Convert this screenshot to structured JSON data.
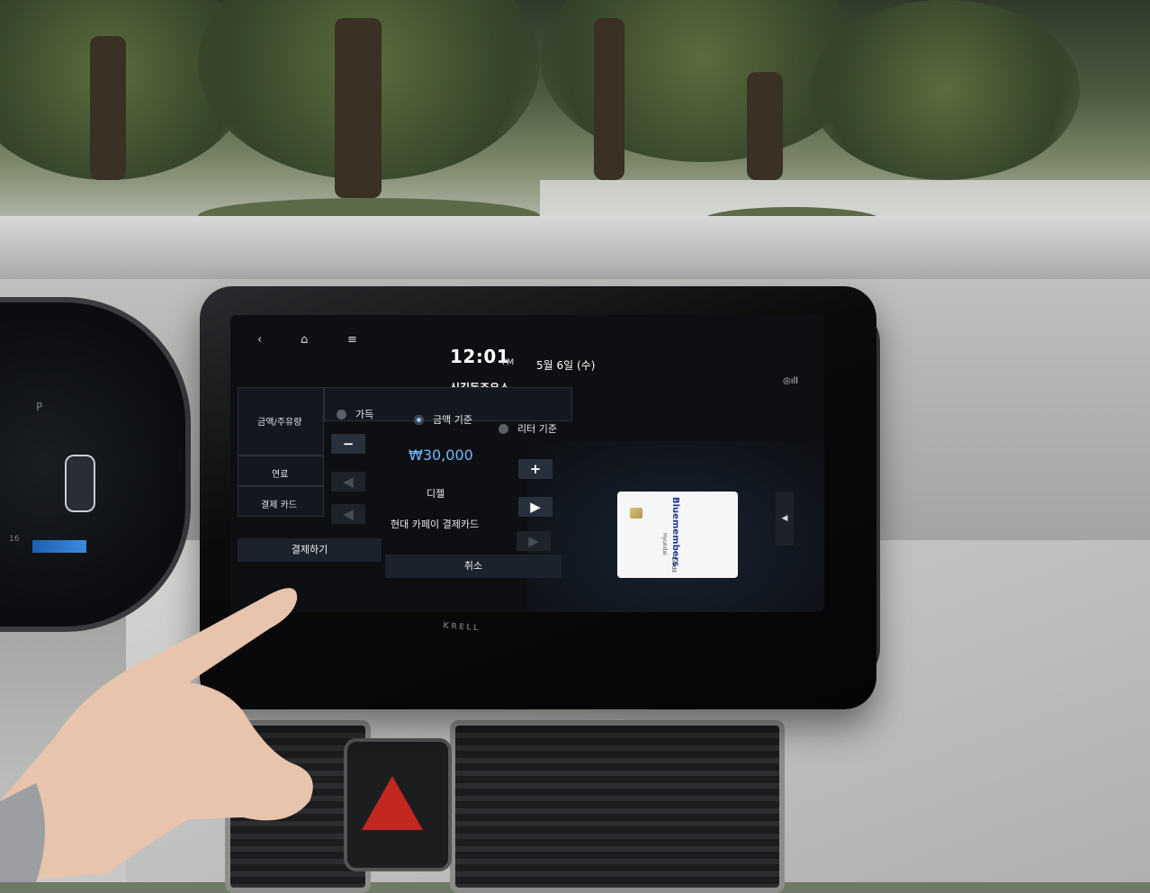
{
  "screen": {
    "time": "12:01",
    "ampm": "PM",
    "date": "5월 6일 (수)",
    "station_name": "신길동주유소",
    "nav": {
      "back": "‹",
      "home": "⌂",
      "menu": "≡"
    },
    "status_icon": "◎ıll",
    "form": {
      "amount_row_label": "금액/주유량",
      "options": [
        {
          "label": "가득",
          "selected": false
        },
        {
          "label": "금액 기준",
          "selected": true
        },
        {
          "label": "리터 기준",
          "selected": false
        }
      ],
      "minus": "−",
      "plus": "+",
      "amount": "₩30,000",
      "fuel_label": "연료",
      "fuel_value": "디젤",
      "card_label": "결제 카드",
      "card_value": "현대 카페이 결제카드",
      "prev": "◀",
      "next": "▶",
      "pay_button": "결제하기",
      "cancel_button": "취소"
    },
    "credit_card": {
      "brand": "Bluemembers",
      "sub": "Credit",
      "issuer": "Hyundai"
    },
    "side_tab": "◀"
  },
  "cluster": {
    "gear": "P",
    "speed_small": "16"
  },
  "bezel_brand": "KRELL",
  "colors": {
    "accent": "#6fb8ff",
    "hazard": "#c2281f",
    "screen_bg": "#0e0f12"
  },
  "icons": [
    "back-icon",
    "home-icon",
    "menu-icon",
    "signal-icon",
    "hazard-icon",
    "card-chip-icon"
  ]
}
